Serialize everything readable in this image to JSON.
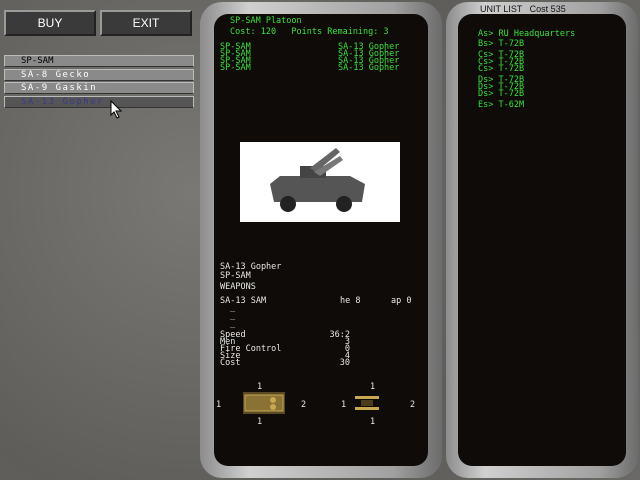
{
  "buttons": {
    "buy": "BUY",
    "exit": "EXIT"
  },
  "unit_types": [
    {
      "label": "SP-SAM",
      "state": "selected"
    },
    {
      "label": "SA-8 Gecko",
      "state": "normal"
    },
    {
      "label": "SA-9 Gaskin",
      "state": "normal"
    },
    {
      "label": "SA-13 Gopher",
      "state": "hover"
    }
  ],
  "platoon": {
    "title": "SP-SAM Platoon",
    "cost_line": "Cost: 120   Points Remaining: 3",
    "rows": [
      [
        "SP-SAM",
        "SA-13 Gopher"
      ],
      [
        "SP-SAM",
        "SA-13 Gopher"
      ],
      [
        "SP-SAM",
        "SA-13 Gopher"
      ],
      [
        "SP-SAM",
        "SA-13 Gopher"
      ]
    ]
  },
  "unit": {
    "name": "SA-13 Gopher",
    "type": "SP-SAM",
    "weapons_label": "WEAPONS",
    "weapon": {
      "name": "SA-13 SAM",
      "he": "he 8",
      "ap": "ap 0"
    },
    "empty_slots": [
      "_",
      "_",
      "_"
    ],
    "stats": [
      [
        "Speed",
        "36:2"
      ],
      [
        "Men",
        "3"
      ],
      [
        "Fire Control",
        "0"
      ],
      [
        "Size",
        "4"
      ],
      [
        "Cost",
        "30"
      ]
    ],
    "armor_side": {
      "top": "1",
      "left": "1",
      "right": "2",
      "bottom": "1"
    },
    "armor_top": {
      "top": "1",
      "left": "1",
      "right": "2",
      "bottom": "1"
    }
  },
  "unit_list": {
    "header": "UNIT LIST   Cost 535",
    "groups": [
      [
        "As> RU Headquarters"
      ],
      [
        "Bs> T-72B"
      ],
      [
        "Cs> T-72B",
        "Cs> T-72B",
        "Cs> T-72B"
      ],
      [
        "Ds> T-72B",
        "Ds> T-72B",
        "Ds> T-72B"
      ],
      [
        "Es> T-62M"
      ]
    ]
  },
  "colors": {
    "text_green": "#3ce03c",
    "panel_black": "#0e0b08"
  }
}
